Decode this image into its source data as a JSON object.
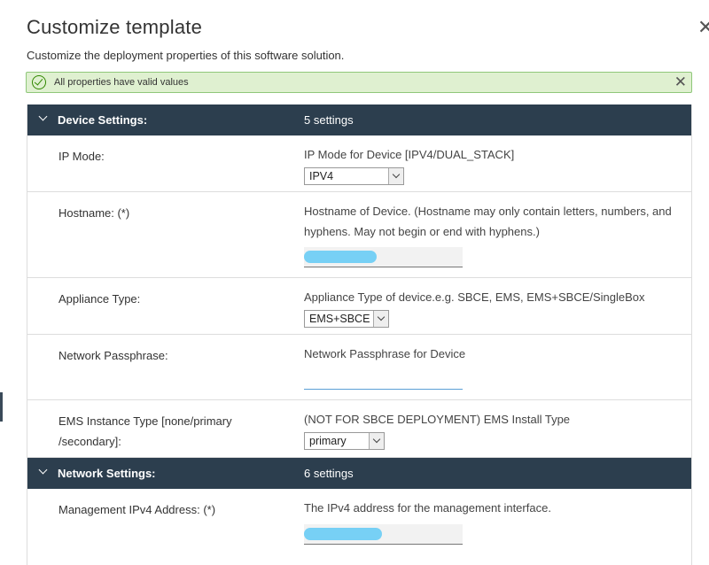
{
  "dialog": {
    "title": "Customize template",
    "subtitle": "Customize the deployment properties of this software solution.",
    "alert_text": "All properties have valid values"
  },
  "groups": [
    {
      "name": "Device Settings:",
      "count": "5 settings"
    },
    {
      "name": "Network Settings:",
      "count": "6 settings"
    }
  ],
  "fields": {
    "ip_mode": {
      "label": "IP Mode:",
      "desc": "IP Mode for Device [IPV4/DUAL_STACK]",
      "value": "IPV4"
    },
    "hostname": {
      "label": "Hostname: (*)",
      "desc": "Hostname of Device. (Hostname may only contain letters, numbers, and hyphens. May not begin or end with hyphens.)"
    },
    "appliance_type": {
      "label": "Appliance Type:",
      "desc": "Appliance Type of device.e.g. SBCE, EMS, EMS+SBCE/SingleBox",
      "value": "EMS+SBCE"
    },
    "network_passphrase": {
      "label": "Network Passphrase:",
      "desc": "Network Passphrase for Device"
    },
    "ems_instance_type": {
      "label": "EMS Instance Type [none/primary /secondary]:",
      "desc": "(NOT FOR SBCE DEPLOYMENT) EMS Install Type",
      "value": "primary"
    },
    "mgmt_ipv4": {
      "label": "Management IPv4 Address: (*)",
      "desc": "The IPv4 address for the management interface."
    }
  }
}
